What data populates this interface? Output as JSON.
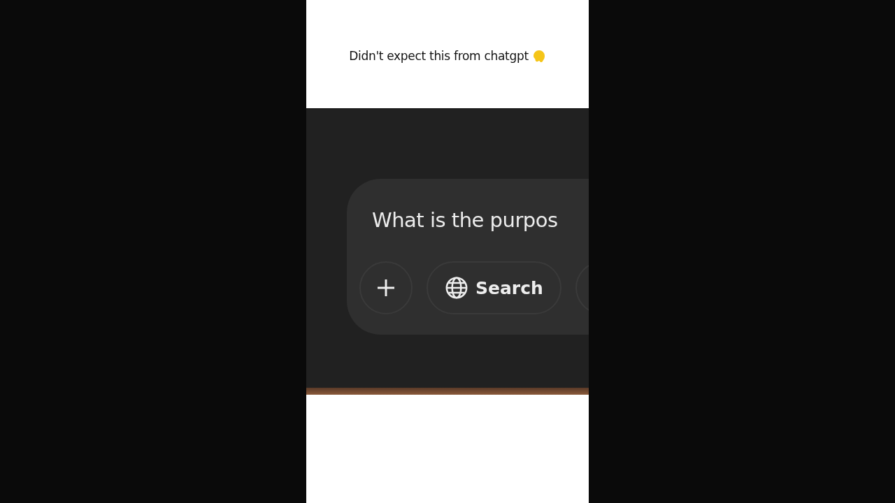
{
  "caption": {
    "text": "Didn't expect this from chatgpt"
  },
  "chat": {
    "prompt": "What is the purpos",
    "buttons": [
      {
        "kind": "add"
      },
      {
        "kind": "search",
        "label": "Search"
      },
      {
        "kind": "cut"
      }
    ]
  }
}
